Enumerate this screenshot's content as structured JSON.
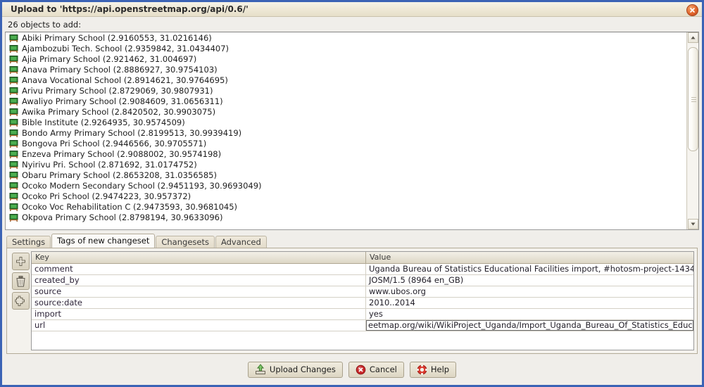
{
  "window": {
    "title": "Upload to 'https://api.openstreetmap.org/api/0.6/'",
    "close_icon": "close-icon",
    "border_color": "#3b63b5",
    "titlebar_color": "#efe9d8"
  },
  "objects": {
    "count_label": "26 objects to add:",
    "item_icon": "school-icon",
    "items": [
      {
        "name": "Abiki Primary School",
        "coords": "(2.9160553, 31.0216146)"
      },
      {
        "name": "Ajambozubi Tech. School",
        "coords": "(2.9359842, 31.0434407)"
      },
      {
        "name": "Ajia Primary School",
        "coords": "(2.921462, 31.004697)"
      },
      {
        "name": "Anava Primary School",
        "coords": "(2.8886927, 30.9754103)"
      },
      {
        "name": "Anava Vocational School",
        "coords": "(2.8914621, 30.9764695)"
      },
      {
        "name": "Arivu Primary School",
        "coords": "(2.8729069, 30.9807931)"
      },
      {
        "name": "Awaliyo Primary School",
        "coords": "(2.9084609, 31.0656311)"
      },
      {
        "name": "Awika Primary School",
        "coords": "(2.8420502, 30.9903075)"
      },
      {
        "name": "Bible Institute",
        "coords": "(2.9264935, 30.9574509)"
      },
      {
        "name": "Bondo Army Primary School",
        "coords": "(2.8199513, 30.9939419)"
      },
      {
        "name": "Bongova Pri School",
        "coords": "(2.9446566, 30.9705571)"
      },
      {
        "name": "Enzeva Primary School",
        "coords": "(2.9088002, 30.9574198)"
      },
      {
        "name": "Nyirivu Pri. School",
        "coords": "(2.871692, 31.0174752)"
      },
      {
        "name": "Obaru Primary School",
        "coords": "(2.8653208, 31.0356585)"
      },
      {
        "name": "Ocoko Modern Secondary School",
        "coords": "(2.9451193, 30.9693049)"
      },
      {
        "name": "Ocoko Pri School",
        "coords": "(2.9474223, 30.957372)"
      },
      {
        "name": "Ocoko Voc Rehabilitation C",
        "coords": "(2.9473593, 30.9681045)"
      },
      {
        "name": "Okpova Primary School",
        "coords": "(2.8798194, 30.9633096)"
      }
    ]
  },
  "tabs": [
    {
      "label": "Settings",
      "selected": false
    },
    {
      "label": "Tags of new changeset",
      "selected": true
    },
    {
      "label": "Changesets",
      "selected": false
    },
    {
      "label": "Advanced",
      "selected": false
    }
  ],
  "tag_tools": [
    {
      "icon": "add-icon",
      "name": "add-tag-button"
    },
    {
      "icon": "trash-icon",
      "name": "delete-tag-button"
    },
    {
      "icon": "paste-tags-icon",
      "name": "paste-tags-button"
    }
  ],
  "tag_table": {
    "columns": [
      "Key",
      "Value"
    ],
    "rows": [
      {
        "key": "comment",
        "value": "Uganda Bureau of Statistics Educational Facilities import, #hotosm-project-1434",
        "editing": false
      },
      {
        "key": "created_by",
        "value": "JOSM/1.5 (8964 en_GB)",
        "editing": false
      },
      {
        "key": "source",
        "value": "www.ubos.org",
        "editing": false
      },
      {
        "key": "source:date",
        "value": "2010..2014",
        "editing": false
      },
      {
        "key": "import",
        "value": "yes",
        "editing": false
      },
      {
        "key": "url",
        "value": "eetmap.org/wiki/WikiProject_Uganda/Import_Uganda_Bureau_Of_Statistics_Education_Facilities",
        "editing": true
      }
    ]
  },
  "footer": {
    "buttons": [
      {
        "label": "Upload Changes",
        "icon": "upload-icon",
        "name": "upload-changes-button"
      },
      {
        "label": "Cancel",
        "icon": "cancel-icon",
        "name": "cancel-button"
      },
      {
        "label": "Help",
        "icon": "help-icon",
        "name": "help-button"
      }
    ]
  }
}
